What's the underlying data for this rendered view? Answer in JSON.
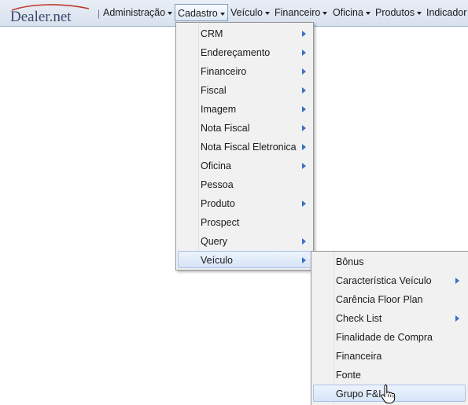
{
  "brand": {
    "logo_text": "Dealer.net"
  },
  "menubar": {
    "separator": "|",
    "items": [
      {
        "label": "Administração"
      },
      {
        "label": "Cadastro"
      },
      {
        "label": "Veículo"
      },
      {
        "label": "Financeiro"
      },
      {
        "label": "Oficina"
      },
      {
        "label": "Produtos"
      },
      {
        "label": "Indicador"
      }
    ],
    "active": "Cadastro"
  },
  "cadastro_menu": {
    "items": [
      {
        "label": "CRM",
        "submenu": true
      },
      {
        "label": "Endereçamento",
        "submenu": true
      },
      {
        "label": "Financeiro",
        "submenu": true
      },
      {
        "label": "Fiscal",
        "submenu": true
      },
      {
        "label": "Imagem",
        "submenu": true
      },
      {
        "label": "Nota Fiscal",
        "submenu": true
      },
      {
        "label": "Nota Fiscal Eletronica",
        "submenu": true
      },
      {
        "label": "Oficina",
        "submenu": true
      },
      {
        "label": "Pessoa",
        "submenu": false
      },
      {
        "label": "Produto",
        "submenu": true
      },
      {
        "label": "Prospect",
        "submenu": false
      },
      {
        "label": "Query",
        "submenu": true
      },
      {
        "label": "Veículo",
        "submenu": true
      }
    ],
    "highlighted": "Veículo"
  },
  "veiculo_menu": {
    "items": [
      {
        "label": "Bônus",
        "submenu": false
      },
      {
        "label": "Característica Veículo",
        "submenu": true
      },
      {
        "label": "Carência Floor Plan",
        "submenu": false
      },
      {
        "label": "Check List",
        "submenu": true
      },
      {
        "label": "Finalidade de Compra",
        "submenu": false
      },
      {
        "label": "Financeira",
        "submenu": false
      },
      {
        "label": "Fonte",
        "submenu": false
      },
      {
        "label": "Grupo F&I",
        "submenu": false
      }
    ],
    "highlighted": "Grupo F&I"
  },
  "colors": {
    "menubar_bg": "#dde5f0",
    "highlight_bg": "#d5e4f8",
    "highlight_border": "#a8c3e8",
    "submenu_arrow": "#3b6fc6",
    "logo_swoosh": "#c0392b"
  },
  "icons": {
    "cursor": "hand-pointer-icon",
    "submenu": "triangle-right-icon",
    "caret": "caret-down-icon"
  }
}
